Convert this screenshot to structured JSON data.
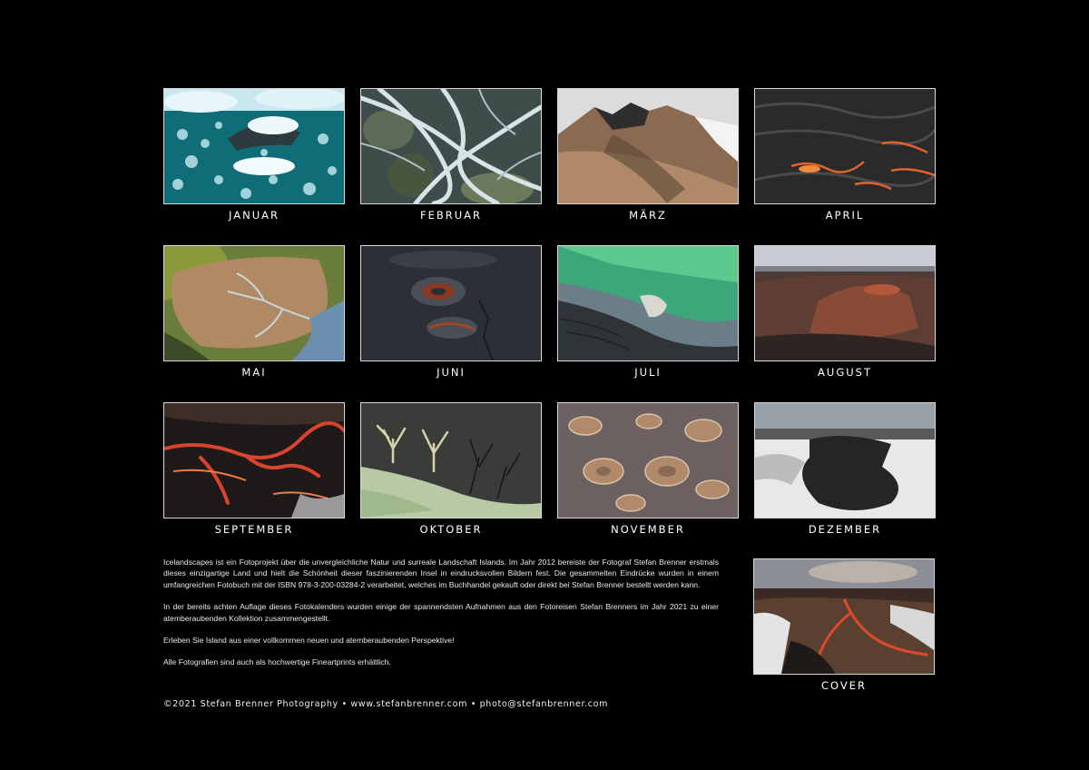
{
  "months": [
    {
      "label": "JANUAR",
      "scene": "glacier-lagoon"
    },
    {
      "label": "FEBRUAR",
      "scene": "braided-river"
    },
    {
      "label": "MÄRZ",
      "scene": "mountain-slopes"
    },
    {
      "label": "APRIL",
      "scene": "lava-flow"
    },
    {
      "label": "MAI",
      "scene": "river-delta"
    },
    {
      "label": "JUNI",
      "scene": "volcanic-craters"
    },
    {
      "label": "JULI",
      "scene": "green-lagoon"
    },
    {
      "label": "AUGUST",
      "scene": "crater-highlands"
    },
    {
      "label": "SEPTEMBER",
      "scene": "lava-rivers"
    },
    {
      "label": "OKTOBER",
      "scene": "river-tributaries"
    },
    {
      "label": "NOVEMBER",
      "scene": "geothermal-patterns"
    },
    {
      "label": "DEZEMBER",
      "scene": "snow-lava-field"
    }
  ],
  "cover": {
    "label": "COVER",
    "scene": "eruption-aerial"
  },
  "description": [
    "Icelandscapes ist ein Fotoprojekt über die unvergleichliche Natur und surreale Landschaft Islands. Im Jahr 2012 bereiste der Fotograf Stefan Brenner erstmals dieses einzigartige Land und hielt die Schönheit dieser faszinierenden Insel in eindrucksvollen Bildern fest. Die gesammelten Eindrücke wurden in einem umfangreichen Fotobuch mit der ISBN 978-3-200-03284-2 verarbeitet, welches im Buchhandel gekauft oder direkt bei Stefan Brenner bestellt werden kann.",
    "In der bereits achten Auflage dieses Fotokalenders wurden einige der spannendsten Aufnahmen aus den Fotoreisen Stefan Brenners im Jahr 2021 zu einer atemberaubenden Kollektion zusammengestellt.",
    "Erleben Sie Island aus einer vollkommen neuen und atemberaubenden Perspektive!",
    "Alle Fotografien sind auch als hochwertige Fineartprints erhältlich."
  ],
  "footer": "©2021  Stefan Brenner Photography • www.stefanbrenner.com • photo@stefanbrenner.com"
}
